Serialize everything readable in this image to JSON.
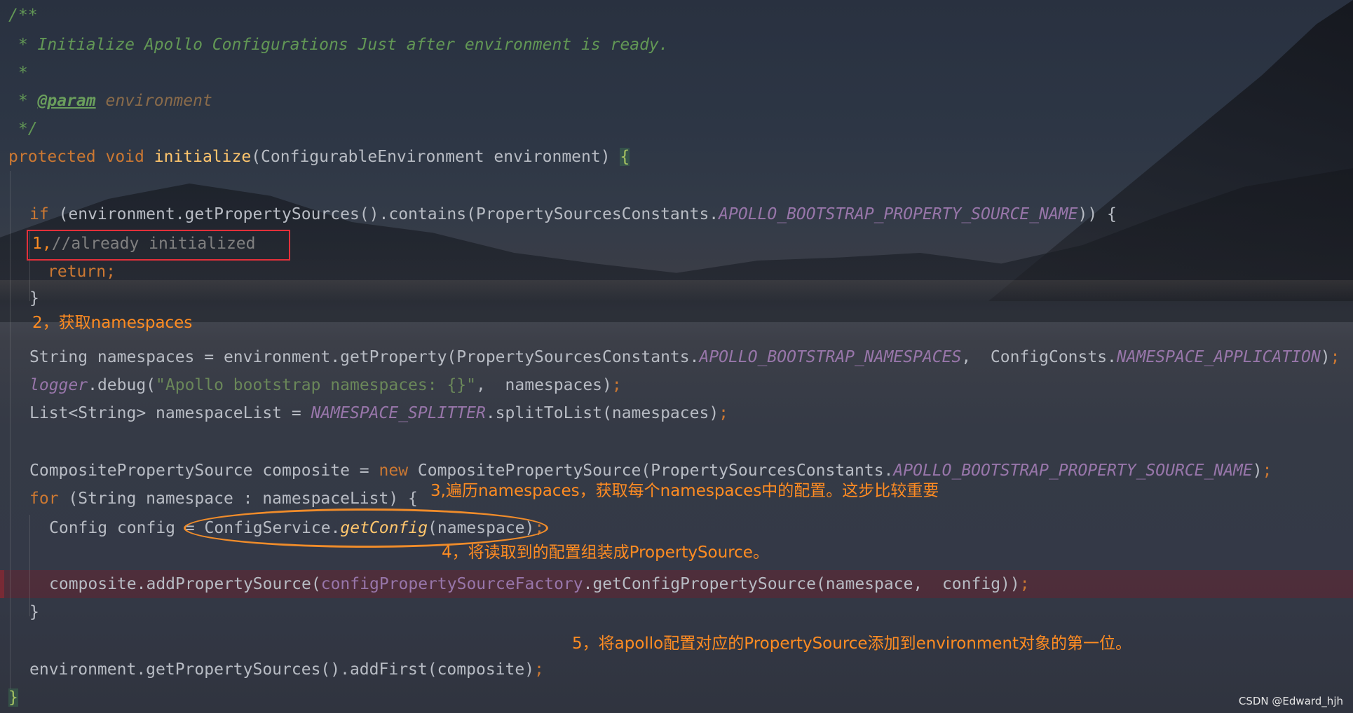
{
  "editor": {
    "lines": {
      "l1": "/**",
      "l2": " * Initialize Apollo Configurations Just after environment is ready.",
      "l3": " *",
      "l4_star": " * ",
      "l4_tag": "@param",
      "l4_param": " environment",
      "l5": " */",
      "sig_kw": "protected void ",
      "sig_fn": "initialize",
      "sig_rest": "(ConfigurableEnvironment environment) ",
      "sig_brace": "{",
      "if_kw": "if ",
      "if_rest": "(environment.getPropertySources().contains(PropertySourcesConstants.",
      "if_const": "APOLLO_BOOTSTRAP_PROPERTY_SOURCE_NAME",
      "if_end": ")) {",
      "cmt_prefix": "1,",
      "cmt_text": "//already initialized",
      "ret_kw": "return",
      "ret_semi": ";",
      "close1": "}",
      "ns_plain": "String namespaces = environment.getProperty(PropertySourcesConstants.",
      "ns_const1": "APOLLO_BOOTSTRAP_NAMESPACES",
      "ns_mid": ",  ConfigConsts.",
      "ns_const2": "NAMESPACE_APPLICATION",
      "ns_end": ")",
      "ns_semi": ";",
      "log_field": "logger",
      "log_mid": ".debug(",
      "log_str": "\"Apollo bootstrap namespaces: {}\"",
      "log_rest": ",  namespaces)",
      "log_semi": ";",
      "list_plain": "List<String> namespaceList = ",
      "list_const": "NAMESPACE_SPLITTER",
      "list_rest": ".splitToList(namespaces)",
      "list_semi": ";",
      "comp_plain": "CompositePropertySource composite = ",
      "comp_kw": "new ",
      "comp_rest": "CompositePropertySource(PropertySourcesConstants.",
      "comp_const": "APOLLO_BOOTSTRAP_PROPERTY_SOURCE_NAME",
      "comp_end": ")",
      "comp_semi": ";",
      "for_kw": "for ",
      "for_rest": "(String namespace : namespaceList) ",
      "for_brace": "{",
      "cfg_plain": "Config config = ConfigService.",
      "cfg_fn": "getConfig",
      "cfg_rest": "(namespace)",
      "cfg_semi": ";",
      "add_plain": "composite.addPropertySource(",
      "add_field": "configPropertySourceFactory",
      "add_rest": ".getConfigPropertySource(namespace,  config))",
      "add_semi": ";",
      "close2": "}",
      "first_plain": "environment.getPropertySources().addFirst(composite)",
      "first_semi": ";",
      "close3": "}"
    }
  },
  "annotations": {
    "a2": "2，获取namespaces",
    "a3": "3,遍历namespaces，获取每个namespaces中的配置。这步比较重要",
    "a4": "4，将读取到的配置组装成PropertySource。",
    "a5": "5，将apollo配置对应的PropertySource添加到environment对象的第一位。"
  },
  "watermark": "CSDN @Edward_hjh",
  "colors": {
    "annotation": "#ff8c22",
    "redbox": "#e3303a",
    "ellipse": "#f08c2a",
    "comment": "#629755",
    "keyword": "#cc7832",
    "constant": "#9876aa"
  }
}
